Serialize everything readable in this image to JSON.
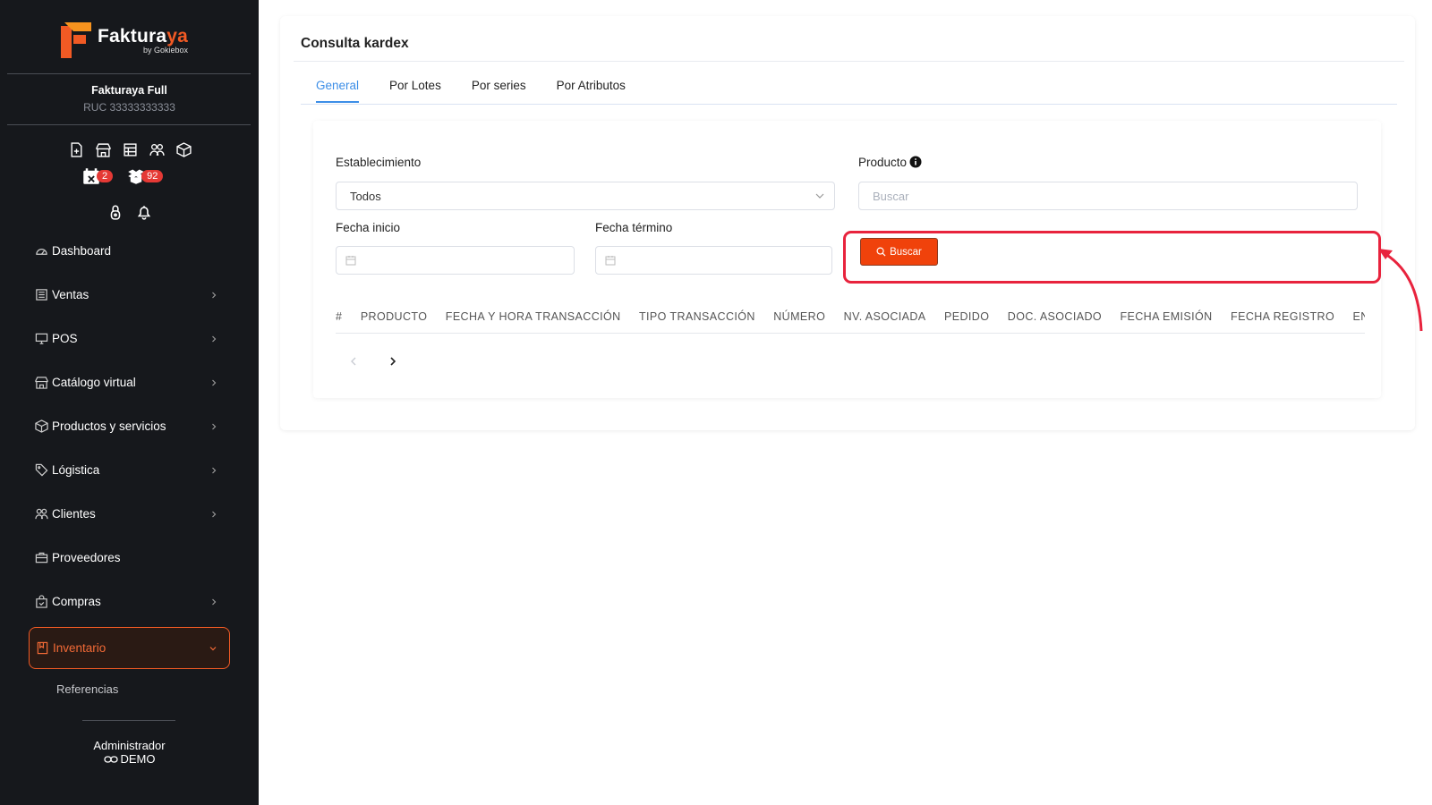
{
  "brand": {
    "name_part1": "Faktura",
    "name_part2": "ya",
    "byline": "by Gokiebox",
    "accent": "#f15a24"
  },
  "company": {
    "name": "Fakturaya Full",
    "ruc": "RUC 33333333333"
  },
  "quick_icons": [
    "document-add-icon",
    "store-icon",
    "table-icon",
    "users-icon",
    "box-icon"
  ],
  "badges": [
    {
      "icon": "calendar-x-icon",
      "count": "2"
    },
    {
      "icon": "box-open-icon",
      "count": "92"
    }
  ],
  "sidebar": {
    "items": [
      {
        "label": "Dashboard",
        "icon": "gauge-icon",
        "has_children": false
      },
      {
        "label": "Ventas",
        "icon": "list-icon",
        "has_children": true
      },
      {
        "label": "POS",
        "icon": "monitor-icon",
        "has_children": true
      },
      {
        "label": "Catálogo virtual",
        "icon": "store-icon",
        "has_children": true
      },
      {
        "label": "Productos y servicios",
        "icon": "box-icon",
        "has_children": true
      },
      {
        "label": "Lógistica",
        "icon": "tag-icon",
        "has_children": true
      },
      {
        "label": "Clientes",
        "icon": "users-icon",
        "has_children": true
      },
      {
        "label": "Proveedores",
        "icon": "briefcase-icon",
        "has_children": false
      },
      {
        "label": "Compras",
        "icon": "bag-icon",
        "has_children": true
      },
      {
        "label": "Inventario",
        "icon": "book-icon",
        "has_children": true,
        "active": true
      }
    ],
    "subitems": [
      {
        "label": "Referencias"
      }
    ]
  },
  "user": {
    "name": "Administrador",
    "role": "DEMO"
  },
  "page": {
    "title": "Consulta kardex",
    "tabs": [
      {
        "label": "General",
        "active": true
      },
      {
        "label": "Por Lotes"
      },
      {
        "label": "Por series"
      },
      {
        "label": "Por Atributos"
      }
    ]
  },
  "form": {
    "establecimiento_label": "Establecimiento",
    "establecimiento_value": "Todos",
    "producto_label": "Producto",
    "producto_placeholder": "Buscar",
    "fecha_inicio_label": "Fecha inicio",
    "fecha_termino_label": "Fecha término",
    "buscar_label": "Buscar"
  },
  "table": {
    "columns": [
      "#",
      "PRODUCTO",
      "FECHA Y HORA TRANSACCIÓN",
      "TIPO TRANSACCIÓN",
      "NÚMERO",
      "NV. ASOCIADA",
      "PEDIDO",
      "DOC. ASOCIADO",
      "FECHA EMISIÓN",
      "FECHA REGISTRO",
      "ENTRADA"
    ]
  },
  "colors": {
    "primary": "#f0420b",
    "tab_active": "#3c8ee7",
    "highlight": "#e8233d",
    "sidebar_bg": "#16181c"
  }
}
